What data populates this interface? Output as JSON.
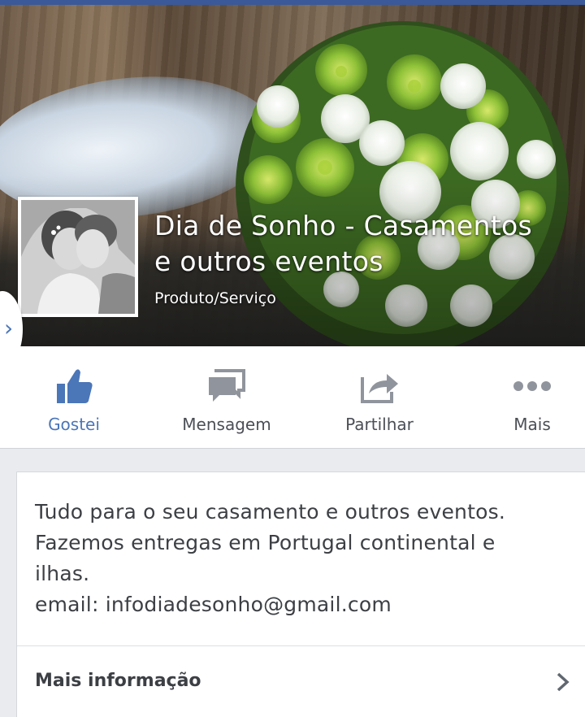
{
  "page": {
    "name": "Dia de Sonho - Casamentos e outros eventos",
    "name_line1": "Dia de Sonho - Casamentos",
    "name_line2": "e outros eventos",
    "category": "Produto/Serviço"
  },
  "actions": [
    {
      "label": "Gostei",
      "icon": "thumbs-up-icon",
      "active": true
    },
    {
      "label": "Mensagem",
      "icon": "message-icon"
    },
    {
      "label": "Partilhar",
      "icon": "share-icon"
    },
    {
      "label": "Mais",
      "icon": "more-icon"
    }
  ],
  "about": {
    "lines": [
      "Tudo para o seu casamento e outros eventos.",
      "Fazemos entregas em Portugal continental e",
      "ilhas.",
      "email: infodiadesonho@gmail.com"
    ],
    "more_info_label": "Mais informação"
  },
  "colors": {
    "accent": "#4b76b8",
    "topbar": "#3b5998",
    "text": "#3c3f44",
    "icon_gray": "#90949c"
  }
}
